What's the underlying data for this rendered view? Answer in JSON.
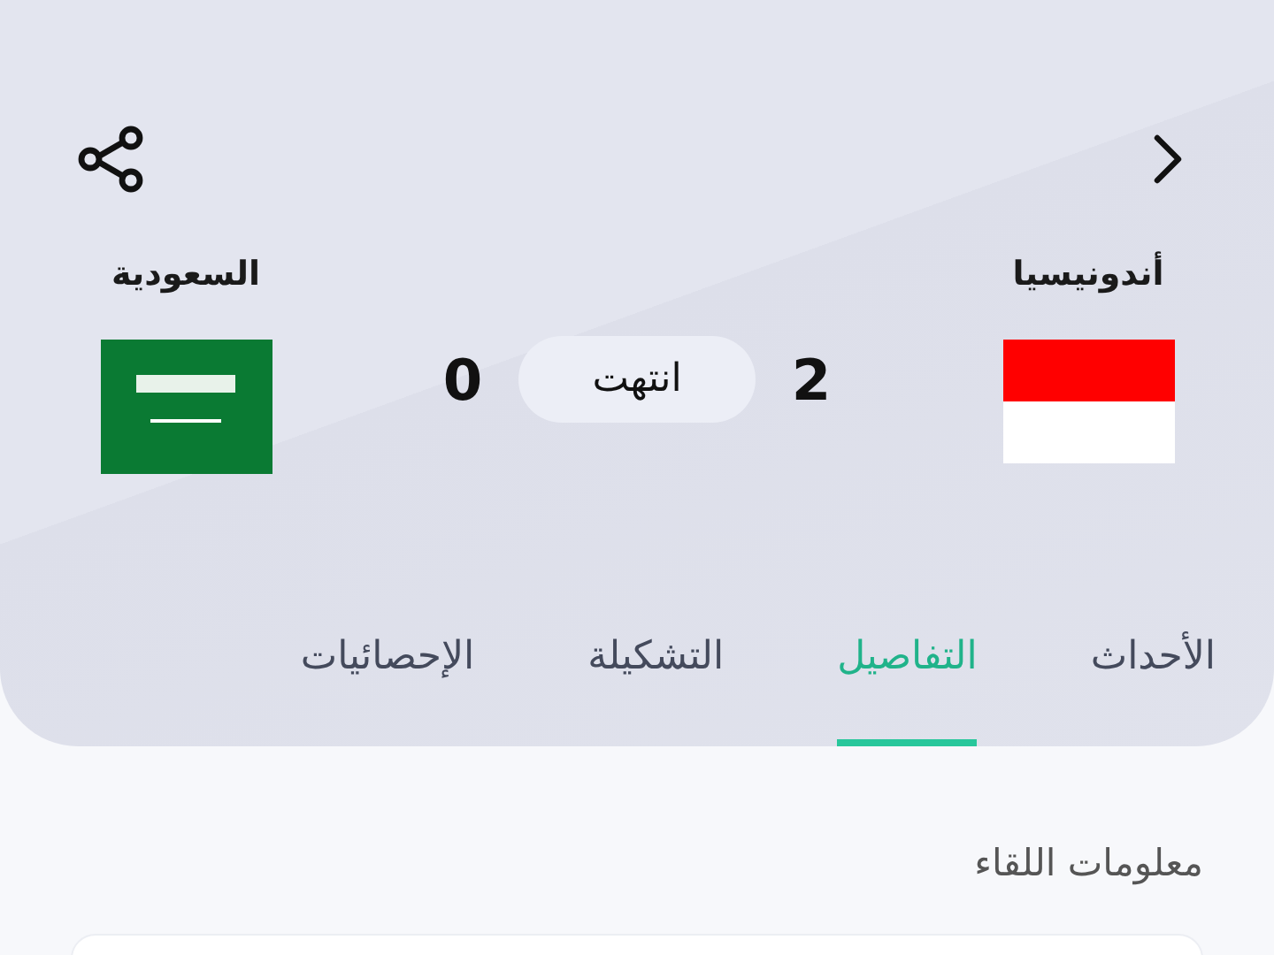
{
  "match": {
    "home": {
      "name": "أندونيسيا",
      "score": "2",
      "kind": "indonesia"
    },
    "away": {
      "name": "السعودية",
      "score": "0",
      "kind": "saudi"
    },
    "status": "انتهت"
  },
  "tabs": [
    {
      "label": "الأحداث",
      "selected": false
    },
    {
      "label": "التفاصيل",
      "selected": true
    },
    {
      "label": "التشكيلة",
      "selected": false
    },
    {
      "label": "الإحصائيات",
      "selected": false
    }
  ],
  "section": {
    "title": "معلومات اللقاء"
  }
}
